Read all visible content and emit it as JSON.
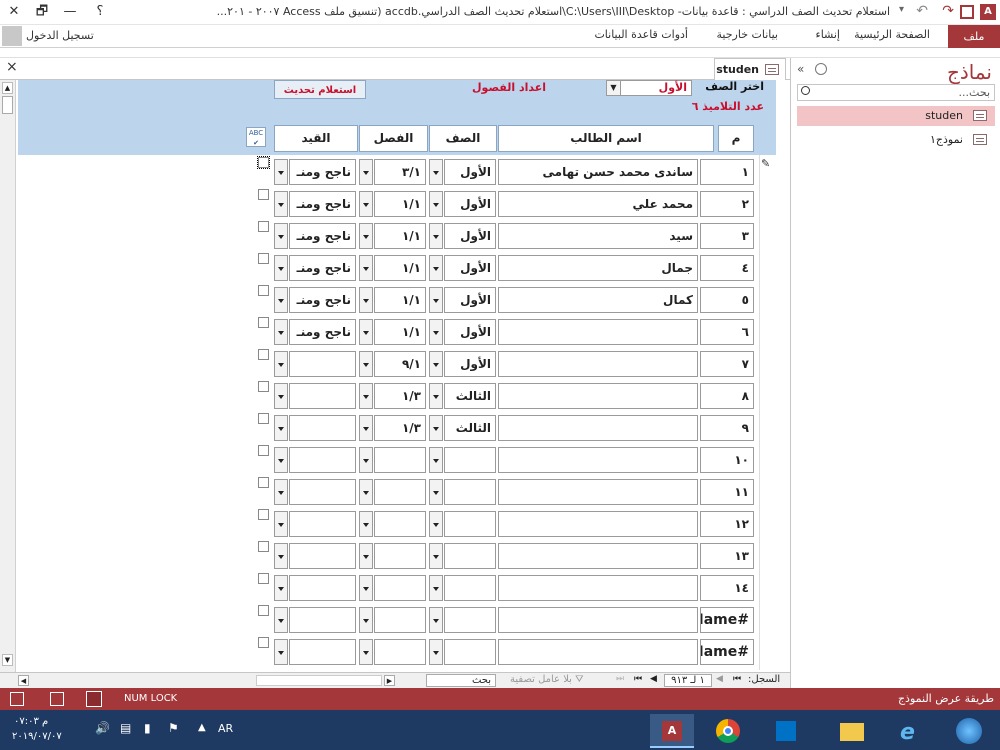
{
  "window": {
    "title": "استعلام تحديث الصف الدراسي : قاعدة بيانات- C:\\Users\\III\\Desktop\\استعلام تحديث الصف الدراسي.accdb (تنسيق ملف Access ٢٠٠٧ - ٢٠١...",
    "help": "؟",
    "minimize": "—",
    "restore": "🗗",
    "close": "✕"
  },
  "ribbon": {
    "file": "ملف",
    "tabs": [
      "الصفحة الرئيسية",
      "إنشاء",
      "بيانات خارجية",
      "أدوات قاعدة البيانات"
    ],
    "signin": "تسجيل الدخول"
  },
  "nav": {
    "title": "نماذج",
    "search_placeholder": "بحث...",
    "items": [
      "studen",
      "نموذج١"
    ]
  },
  "doc": {
    "tab_label": "studen",
    "close": "×"
  },
  "form": {
    "choose_class_label": "اختر الصف",
    "choose_class_value": "الأول",
    "classes_count_label": "اعداد الفصول",
    "update_button": "استعلام تحديث",
    "students_count": "عدد التلاميذ ٦",
    "columns": [
      "م",
      "اسم الطالب",
      "الصف",
      "الفصل",
      "القيد"
    ],
    "rows": [
      {
        "num": "١",
        "name": "ساندى محمد حسن تهامى",
        "grade": "الأول",
        "section": "٣/١",
        "status": "ناجح ومنـ",
        "checked": false
      },
      {
        "num": "٢",
        "name": "محمد علي",
        "grade": "الأول",
        "section": "١/١",
        "status": "ناجح ومنـ",
        "checked": false
      },
      {
        "num": "٣",
        "name": "سيد",
        "grade": "الأول",
        "section": "١/١",
        "status": "ناجح ومنـ",
        "checked": false
      },
      {
        "num": "٤",
        "name": "جمال",
        "grade": "الأول",
        "section": "١/١",
        "status": "ناجح ومنـ",
        "checked": false
      },
      {
        "num": "٥",
        "name": "كمال",
        "grade": "الأول",
        "section": "١/١",
        "status": "ناجح ومنـ",
        "checked": false
      },
      {
        "num": "٦",
        "name": "",
        "grade": "الأول",
        "section": "١/١",
        "status": "ناجح ومنـ",
        "checked": false
      },
      {
        "num": "٧",
        "name": "",
        "grade": "الأول",
        "section": "٩/١",
        "status": "",
        "checked": false
      },
      {
        "num": "٨",
        "name": "",
        "grade": "الثالث",
        "section": "١/٣",
        "status": "",
        "checked": false
      },
      {
        "num": "٩",
        "name": "",
        "grade": "الثالث",
        "section": "١/٣",
        "status": "",
        "checked": false
      },
      {
        "num": "١٠",
        "name": "",
        "grade": "",
        "section": "",
        "status": "",
        "checked": false
      },
      {
        "num": "١١",
        "name": "",
        "grade": "",
        "section": "",
        "status": "",
        "checked": false
      },
      {
        "num": "١٢",
        "name": "",
        "grade": "",
        "section": "",
        "status": "",
        "checked": false
      },
      {
        "num": "١٣",
        "name": "",
        "grade": "",
        "section": "",
        "status": "",
        "checked": false
      },
      {
        "num": "١٤",
        "name": "",
        "grade": "",
        "section": "",
        "status": "",
        "checked": false
      },
      {
        "num": "#Name?",
        "name": "",
        "grade": "",
        "section": "",
        "status": "",
        "checked": false
      },
      {
        "num": "#Name?",
        "name": "",
        "grade": "",
        "section": "",
        "status": "",
        "checked": false
      }
    ]
  },
  "recordnav": {
    "label": "السجل:",
    "position": "١ لـ ٩١٣",
    "no_filter": "بلا عامل تصفية",
    "search": "بحث"
  },
  "statusbar": {
    "view": "طريقة عرض النموذج",
    "numlock": "NUM LOCK"
  },
  "taskbar": {
    "time": "م ٠٧:٠٣",
    "date": "٢٠١٩/٠٧/٠٧",
    "lang": "AR"
  }
}
